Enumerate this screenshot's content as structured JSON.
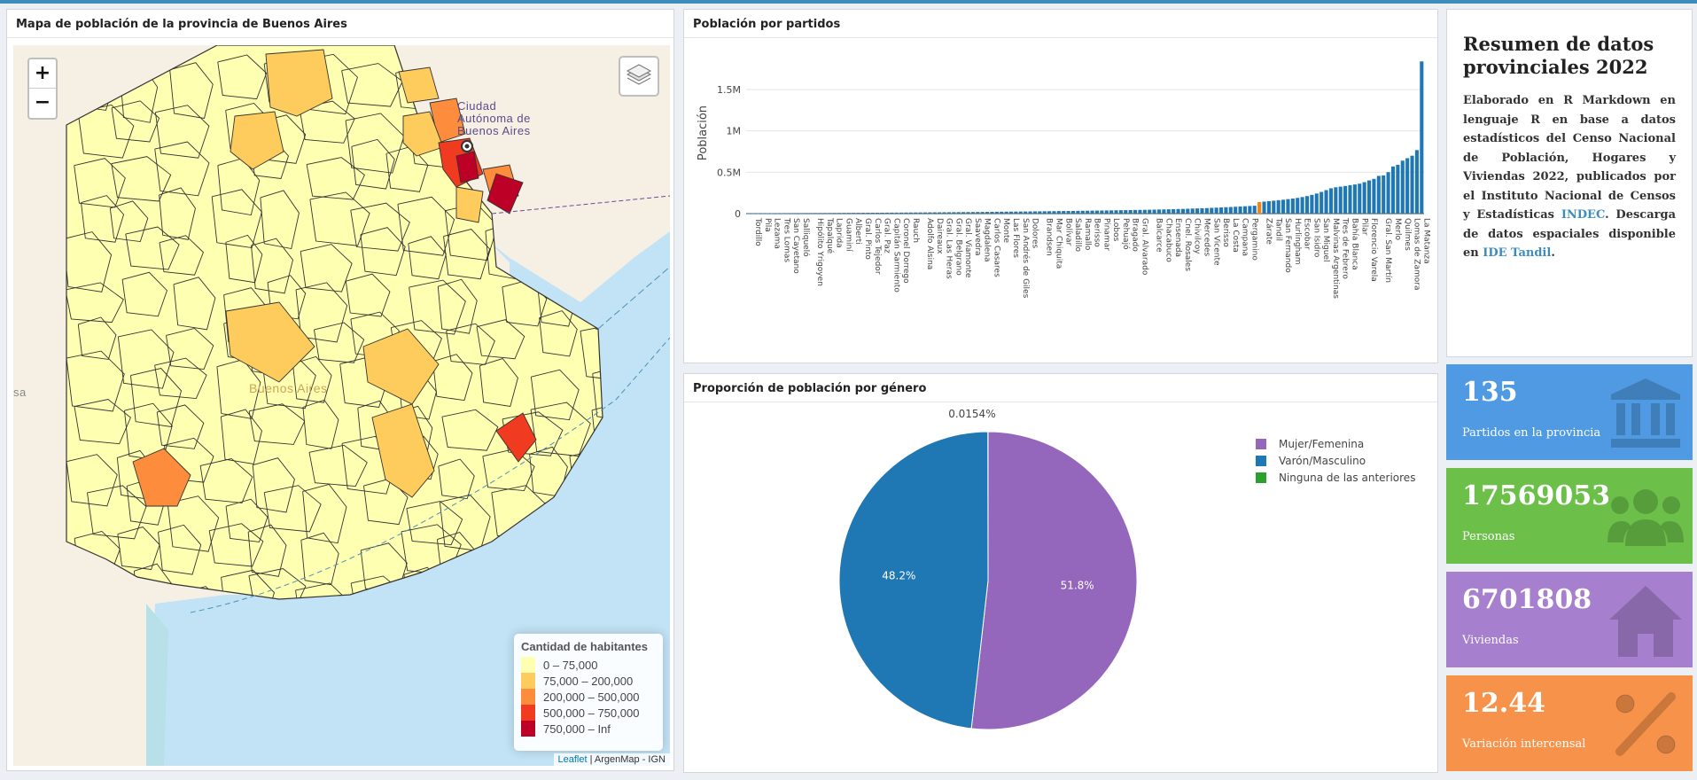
{
  "map": {
    "title": "Mapa de población de la provincia de Buenos Aires",
    "zoom_in": "+",
    "zoom_out": "−",
    "label_caba": [
      "Ciudad",
      "Autónoma de",
      "Buenos Aires"
    ],
    "label_province": "Buenos Aires",
    "label_edge": "sa",
    "legend": {
      "title": "Cantidad de habitantes",
      "items": [
        {
          "label": "0 – 75,000",
          "color": "#ffffb2"
        },
        {
          "label": "75,000 – 200,000",
          "color": "#fecc5c"
        },
        {
          "label": "200,000 – 500,000",
          "color": "#fd8d3c"
        },
        {
          "label": "500,000 – 750,000",
          "color": "#f03b20"
        },
        {
          "label": "750,000 – Inf",
          "color": "#bd0026"
        }
      ]
    },
    "attribution": {
      "leaflet": "Leaflet",
      "rest": " | ArgenMap - IGN"
    }
  },
  "bar_panel": {
    "title": "Población por partidos"
  },
  "pie_panel": {
    "title": "Proporción de población por género"
  },
  "summary": {
    "title": "Resumen de datos provinciales 2022",
    "text_1": "Elaborado en R Markdown en lenguaje R en base a datos estadísticos del Censo Nacional de Población, Hogares y Viviendas 2022, publicados por el Instituto Nacional de Censos y Estadísticas ",
    "link_1": "INDEC",
    "text_2": ". Descarga de datos espaciales disponible en ",
    "link_2": "IDE Tandil",
    "text_3": "."
  },
  "value_boxes": [
    {
      "value": "135",
      "label": "Partidos en la provincia",
      "icon": "institution-icon",
      "color": "#4f9ae2"
    },
    {
      "value": "17569053",
      "label": "Personas",
      "icon": "users-icon",
      "color": "#6cc04a"
    },
    {
      "value": "6701808",
      "label": "Viviendas",
      "icon": "house-icon",
      "color": "#a67fce"
    },
    {
      "value": "12.44",
      "label": "Variación intercensal",
      "icon": "percent-icon",
      "color": "#f7924a"
    }
  ],
  "chart_data": [
    {
      "type": "bar",
      "ylabel": "Población",
      "yticks": [
        {
          "v": 0,
          "t": "0"
        },
        {
          "v": 500000,
          "t": "0.5M"
        },
        {
          "v": 1000000,
          "t": "1M"
        },
        {
          "v": 1500000,
          "t": "1.5M"
        }
      ],
      "ylim": [
        0,
        1950000
      ],
      "bar_color": "#1f77b4",
      "highlight_color": "#ff7f0e",
      "highlight_index": 107,
      "categories_labeled": [
        "Tordillo",
        "Pila",
        "Lezama",
        "Tres Lomas",
        "San Cayetano",
        "Salliqueló",
        "Hipólito Yrigoyen",
        "Tapalqué",
        "Laprida",
        "Guaminí",
        "Alberti",
        "Gral. Pinto",
        "Carlos Tejedor",
        "Gral. Paz",
        "Capitán Sarmiento",
        "Coronel Dorrego",
        "Rauch",
        "Adolfo Alsina",
        "Daireaux",
        "Gral. Las Heras",
        "Gral. Belgrano",
        "Gral. Viamonte",
        "Saavedra",
        "Magdalena",
        "Carlos Casares",
        "Monte",
        "Las Flores",
        "San Andrés de Giles",
        "Dolores",
        "Brandsen",
        "Mar Chiquita",
        "Bolívar",
        "Saladillo",
        "Ramallo",
        "Berisso",
        "Pinamar",
        "Lobos",
        "Pehuajó",
        "Bragado",
        "Gral. Alvarado",
        "Balcarce",
        "Chacabuco",
        "Ensenada",
        "Cnel. Rosales",
        "Chivilcoy",
        "Mercedes",
        "San Vicente",
        "Berisso",
        "La Costa",
        "Campana",
        "Pergamino",
        "Zárate",
        "Tandil",
        "San Fernando",
        "Hurlingham",
        "Escobar",
        "San Isidro",
        "San Miguel",
        "Malvinas Argentinas",
        "Tres de Febrero",
        "Bahía Blanca",
        "Pilar",
        "Florencio Varela",
        "Gral. San Martín",
        "Merlo",
        "Quilmes",
        "Lomas de Zamora",
        "La Matanza"
      ],
      "values": [
        3000,
        3600,
        4500,
        5000,
        5200,
        5400,
        5600,
        5900,
        6100,
        6300,
        6500,
        6700,
        7000,
        7200,
        7400,
        7600,
        7800,
        8000,
        8200,
        8500,
        8800,
        9100,
        9400,
        9700,
        10000,
        10300,
        10600,
        10900,
        11200,
        11500,
        11800,
        12100,
        12500,
        12900,
        13300,
        13700,
        14100,
        14500,
        14900,
        15300,
        15800,
        16300,
        16800,
        17300,
        17800,
        18300,
        18800,
        19300,
        19800,
        20300,
        20900,
        21500,
        22100,
        22700,
        23300,
        23900,
        24500,
        25100,
        25700,
        26300,
        27000,
        27700,
        28400,
        29100,
        29800,
        30500,
        31200,
        31900,
        32600,
        33400,
        34200,
        35000,
        35800,
        36600,
        37500,
        38400,
        39300,
        40200,
        41100,
        42000,
        43000,
        44000,
        45000,
        46000,
        47000,
        48000,
        49500,
        51000,
        52500,
        54000,
        55500,
        57000,
        59000,
        61000,
        63000,
        65000,
        67000,
        69500,
        72000,
        74500,
        77000,
        80000,
        83000,
        86000,
        89000,
        92000,
        95000,
        140000,
        145000,
        150000,
        156000,
        162000,
        168000,
        175000,
        182000,
        190000,
        200000,
        212000,
        226000,
        243000,
        262000,
        284000,
        306000,
        318000,
        326000,
        334000,
        344000,
        352000,
        362000,
        380000,
        401000,
        420000,
        456000,
        462000,
        501000,
        570000,
        590000,
        640000,
        670000,
        700000,
        768000,
        1840000
      ]
    },
    {
      "type": "pie",
      "slices": [
        {
          "label": "Mujer/Femenina",
          "value": 51.8,
          "text": "51.8%",
          "color": "#9467bd"
        },
        {
          "label": "Varón/Masculino",
          "value": 48.2,
          "text": "48.2%",
          "color": "#1f77b4"
        },
        {
          "label": "Ninguna de las anteriores",
          "value": 0.0154,
          "text": "0.0154%",
          "color": "#2ca02c"
        }
      ]
    }
  ]
}
